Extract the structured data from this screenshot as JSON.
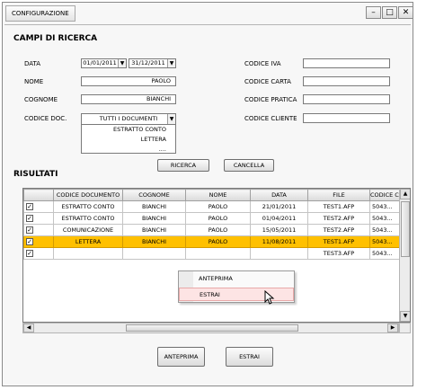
{
  "window": {
    "tab_title": "CONFIGURAZIONE",
    "controls": [
      "–",
      "□",
      "✕"
    ]
  },
  "search": {
    "section_title": "CAMPI DI RICERCA",
    "data_label": "DATA",
    "date_from": "01/01/2011",
    "date_to": "31/12/2011",
    "nome_label": "NOME",
    "nome_value": "PAOLO",
    "cognome_label": "COGNOME",
    "cognome_value": "BIANCHI",
    "codice_doc_label": "CODICE DOC.",
    "codice_doc_selected": "TUTTI I DOCUMENTI",
    "codice_doc_options": [
      "ESTRATTO CONTO",
      "LETTERA",
      "...."
    ],
    "codice_iva_label": "CODICE IVA",
    "codice_carta_label": "CODICE CARTA",
    "codice_pratica_label": "CODICE PRATICA",
    "codice_cliente_label": "CODICE CLIENTE",
    "ricerca_button": "RICERCA",
    "cancella_button": "CANCELLA"
  },
  "results": {
    "section_title": "RISULTATI",
    "columns": [
      "",
      "CODICE DOCUMENTO",
      "COGNOME",
      "NOME",
      "DATA",
      "FILE",
      "CODICE CA"
    ],
    "rows": [
      {
        "checked": true,
        "codice": "ESTRATTO CONTO",
        "cognome": "BIANCHI",
        "nome": "PAOLO",
        "data": "21/01/2011",
        "file": "TEST1.AFP",
        "cod": "5043...",
        "highlight": false
      },
      {
        "checked": true,
        "codice": "ESTRATTO CONTO",
        "cognome": "BIANCHI",
        "nome": "PAOLO",
        "data": "01/04/2011",
        "file": "TEST2.AFP",
        "cod": "5043...",
        "highlight": false
      },
      {
        "checked": true,
        "codice": "COMUNICAZIONE",
        "cognome": "BIANCHI",
        "nome": "PAOLO",
        "data": "15/05/2011",
        "file": "TEST2.AFP",
        "cod": "5043...",
        "highlight": false
      },
      {
        "checked": true,
        "codice": "LETTERA",
        "cognome": "BIANCHI",
        "nome": "PAOLO",
        "data": "11/08/2011",
        "file": "TEST1.AFP",
        "cod": "5043...",
        "highlight": true
      },
      {
        "checked": true,
        "codice": "",
        "cognome": "",
        "nome": "",
        "data": "",
        "file": "TEST3.AFP",
        "cod": "5043...",
        "highlight": false
      }
    ]
  },
  "context_menu": {
    "items": [
      "ANTEPRIMA",
      "ESTRAI"
    ],
    "hovered_index": 1
  },
  "footer": {
    "anteprima_button": "ANTEPRIMA",
    "estrai_button": "ESTRAI"
  },
  "colors": {
    "highlight_row": "#ffc000",
    "menu_hover": "#fde4e4"
  }
}
